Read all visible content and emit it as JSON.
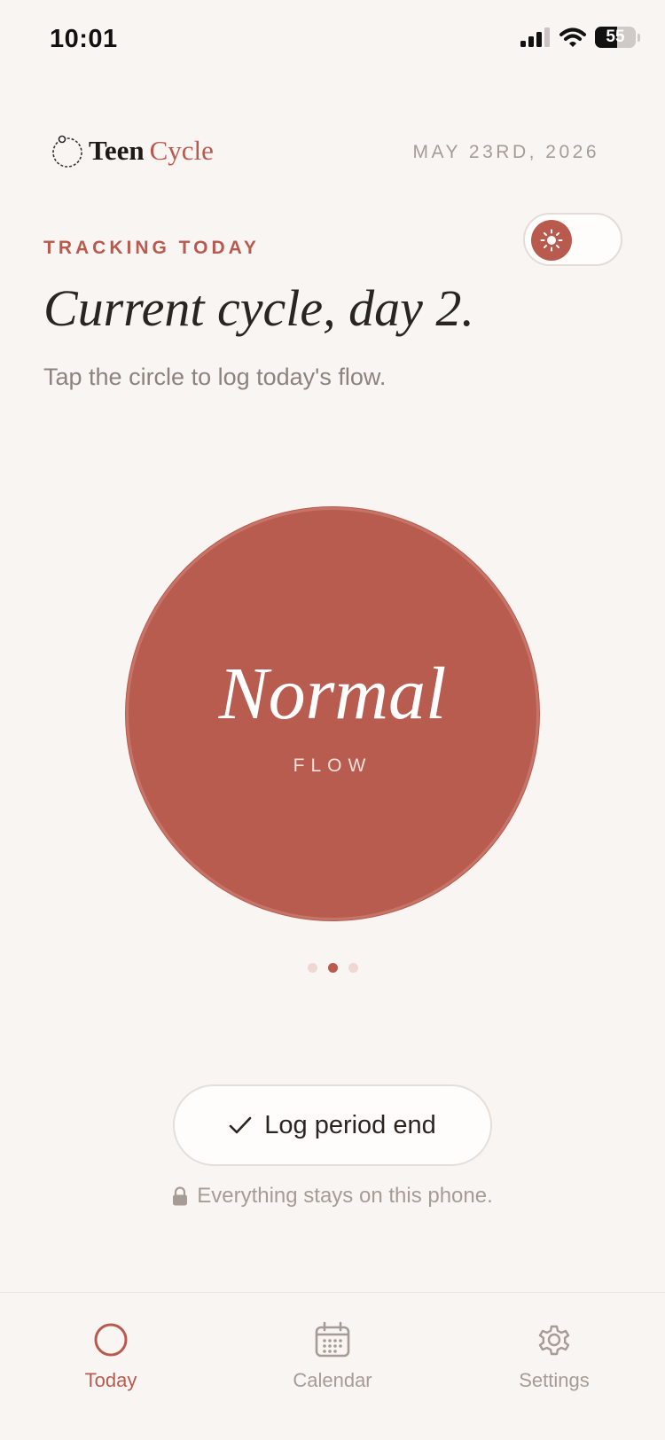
{
  "status_bar": {
    "time": "10:01",
    "battery": "55"
  },
  "header": {
    "brand_primary": "Teen",
    "brand_secondary": "Cycle",
    "date": "MAY 23RD, 2026"
  },
  "tracking": {
    "label": "TRACKING TODAY",
    "title": "Current cycle, day 2.",
    "subtitle": "Tap the circle to log today's flow.",
    "theme_toggle": {
      "icon": "sun-icon",
      "mode": "light"
    }
  },
  "flow": {
    "value": "Normal",
    "unit": "FLOW",
    "page_index": 1,
    "page_count": 3
  },
  "actions": {
    "log_button": "Log period end",
    "privacy_note": "Everything stays on this phone."
  },
  "tabs": [
    {
      "label": "Today",
      "icon": "circle-icon",
      "active": true
    },
    {
      "label": "Calendar",
      "icon": "calendar-icon",
      "active": false
    },
    {
      "label": "Settings",
      "icon": "gear-icon",
      "active": false
    }
  ],
  "colors": {
    "accent": "#b95a4e",
    "background": "#f9f5f2",
    "muted_text": "#a79b95"
  }
}
